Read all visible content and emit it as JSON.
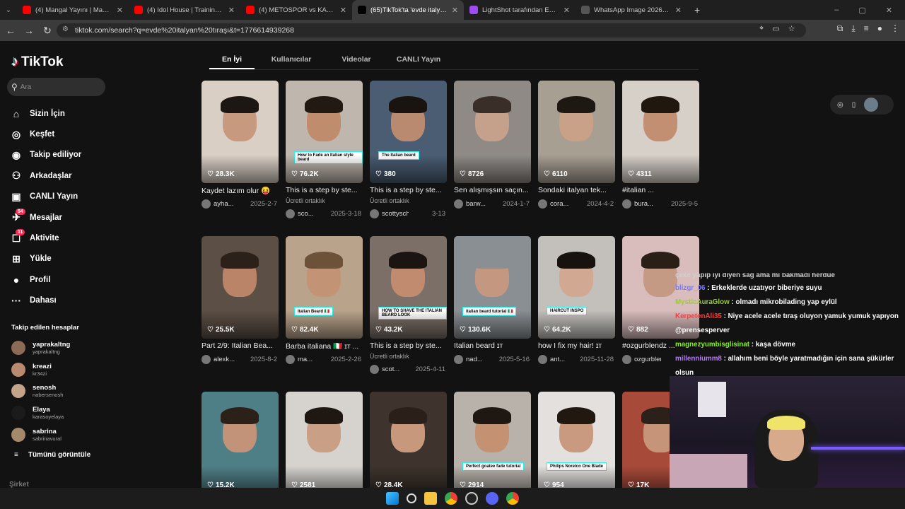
{
  "browser": {
    "tabs": [
      {
        "title": "(4) Mangal Yayını | Mangal ve S",
        "color": "#ff0000",
        "active": false
      },
      {
        "title": "(4) Idol House | Training EP 11 |",
        "color": "#ff0000",
        "active": false
      },
      {
        "title": "(4) METOSPOR vs KADİM FUTBO",
        "color": "#ff0000",
        "active": false
      },
      {
        "title": "(65)TikTok'ta 'evde italyan tıraşı'",
        "color": "#000000",
        "active": true
      },
      {
        "title": "LightShot tarafından Ekran Gör",
        "color": "#9c4cf0",
        "active": false
      },
      {
        "title": "WhatsApp Image 2026-04-15 a",
        "color": "#555555",
        "active": false
      }
    ],
    "new_tab": "+",
    "url": "tiktok.com/search?q=evde%20italyan%20tıraşı&t=1776614939268"
  },
  "tiktok": {
    "brand": "TikTok",
    "search_placeholder": "Ara",
    "nav": [
      {
        "label": "Sizin İçin",
        "icon": "home-icon",
        "glyph": "⌂"
      },
      {
        "label": "Keşfet",
        "icon": "compass-icon",
        "glyph": "◎"
      },
      {
        "label": "Takip ediliyor",
        "icon": "following-icon",
        "glyph": "◉"
      },
      {
        "label": "Arkadaşlar",
        "icon": "friends-icon",
        "glyph": "⚇"
      },
      {
        "label": "CANLI Yayın",
        "icon": "live-icon",
        "glyph": "▣"
      },
      {
        "label": "Mesajlar",
        "icon": "messages-icon",
        "glyph": "✈",
        "badge": "54"
      },
      {
        "label": "Aktivite",
        "icon": "activity-icon",
        "glyph": "☐",
        "badge": "11"
      },
      {
        "label": "Yükle",
        "icon": "upload-icon",
        "glyph": "⊞"
      },
      {
        "label": "Profil",
        "icon": "profile-icon",
        "glyph": "●"
      },
      {
        "label": "Dahası",
        "icon": "more-icon",
        "glyph": "···"
      }
    ],
    "following_title": "Takip edilen hesaplar",
    "following": [
      {
        "name": "yaprakaltng",
        "user": "yaprakaltng"
      },
      {
        "name": "kreazi",
        "user": "kr34zi"
      },
      {
        "name": "senosh",
        "user": "nabersenosh"
      },
      {
        "name": "Elaya",
        "user": "karasoyelaya"
      },
      {
        "name": "sabrina",
        "user": "sabrinavural"
      }
    ],
    "see_all": "Tümünü görüntüle",
    "company": "Şirket",
    "search_tabs": [
      "En İyi",
      "Kullanıcılar",
      "Videolar",
      "CANLI Yayın"
    ],
    "paid_label": "Ücretli ortaklık",
    "videos": [
      {
        "likes": "28.3K",
        "caption": "Kaydet lazım olur 😝",
        "author": "ayha...",
        "date": "2025-2-7",
        "paid": false,
        "bg": "#d9cfc5",
        "skin": "#c79a80",
        "hair": "#1d1713"
      },
      {
        "likes": "76.2K",
        "caption": "This is a step by ste...",
        "author": "sco...",
        "date": "2025-3-18",
        "paid": true,
        "bg": "#bfb6ad",
        "skin": "#c08c6e",
        "hair": "#231913",
        "label": "How to Fade an Italian style beard"
      },
      {
        "likes": "380",
        "caption": "This is a step by ste...",
        "author": "scottysch...",
        "date": "3-13",
        "paid": true,
        "bg": "#4a5d73",
        "skin": "#b98a70",
        "hair": "#1a1411",
        "label": "The Italian beard"
      },
      {
        "likes": "8726",
        "caption": "Sen alışmışsın saçın...",
        "author": "barw...",
        "date": "2024-1-7",
        "paid": false,
        "bg": "#8f8a86",
        "skin": "#c5a08a",
        "hair": "#3a2f28"
      },
      {
        "likes": "6110",
        "caption": "Sondaki italyan tek...",
        "author": "cora...",
        "date": "2024-4-2",
        "paid": false,
        "bg": "#a89f93",
        "skin": "#c9a088",
        "hair": "#1e1813"
      },
      {
        "likes": "4311",
        "caption": "#italian ...",
        "author": "bura...",
        "date": "2025-9-5",
        "paid": false,
        "bg": "#d7d0c9",
        "skin": "#c28f72",
        "hair": "#20180f"
      },
      {
        "likes": "25.5K",
        "caption": "Part 2/9: Italian Bea...",
        "author": "alexk...",
        "date": "2025-8-2",
        "paid": false,
        "bg": "#5c4f45",
        "skin": "#b98468",
        "hair": "#2c2119"
      },
      {
        "likes": "82.4K",
        "caption": "Barba italiana 🇮🇹 ɪᴛ ...",
        "author": "ma...",
        "date": "2025-2-26",
        "paid": false,
        "bg": "#b9a38b",
        "skin": "#c39376",
        "hair": "#6b5238",
        "label": "Italian Beard 🇮🇹"
      },
      {
        "likes": "43.2K",
        "caption": "This is a step by ste...",
        "author": "scot...",
        "date": "2025-4-11",
        "paid": true,
        "bg": "#7b6f67",
        "skin": "#c08b6e",
        "hair": "#1b1410",
        "label": "HOW TO SHAVE THE ITALIAN BEARD LOOK"
      },
      {
        "likes": "130.6K",
        "caption": "Italian beard ɪᴛ",
        "author": "nad...",
        "date": "2025-5-16",
        "paid": false,
        "bg": "#8a8f94",
        "skin": "#c49880",
        "hair": "#8a8f94",
        "label": "italian beard tutorial 🇮🇹"
      },
      {
        "likes": "64.2K",
        "caption": "how I fix my hair! ɪᴛ",
        "author": "ant...",
        "date": "2025-11-28",
        "paid": false,
        "bg": "#c3c0bc",
        "skin": "#d1a891",
        "hair": "#17120e",
        "label": "HAIRCUT INSPO"
      },
      {
        "likes": "882",
        "caption": "#ozgurblendz ...",
        "author": "ozgurblen...",
        "date": "",
        "paid": false,
        "bg": "#d9bcbc",
        "skin": "#c59a85",
        "hair": "#2a1f17"
      },
      {
        "likes": "15.2K",
        "caption": "",
        "author": "",
        "date": "",
        "paid": false,
        "bg": "#4f7f86",
        "skin": "#c29378",
        "hair": "#2b2119"
      },
      {
        "likes": "2581",
        "caption": "",
        "author": "",
        "date": "",
        "paid": false,
        "bg": "#d6d3cf",
        "skin": "#c99f86",
        "hair": "#1f1812"
      },
      {
        "likes": "28.4K",
        "caption": "",
        "author": "",
        "date": "",
        "paid": false,
        "bg": "#3e342d",
        "skin": "#c7987c",
        "hair": "#2a2019"
      },
      {
        "likes": "2914",
        "caption": "",
        "author": "",
        "date": "",
        "paid": false,
        "bg": "#b8b2ab",
        "skin": "#c49173",
        "hair": "#1e1712",
        "label": "Perfect goatee fade tutorial"
      },
      {
        "likes": "954",
        "caption": "",
        "author": "",
        "date": "",
        "paid": false,
        "bg": "#e3e0dd",
        "skin": "#c99a7f",
        "hair": "#21180f",
        "label": "Philips Norelco One Blade"
      },
      {
        "likes": "17K",
        "caption": "",
        "author": "",
        "date": "",
        "paid": false,
        "bg": "#a84a3a",
        "skin": "#c69478",
        "hair": "#2c211a"
      }
    ]
  },
  "chat": [
    {
      "user": "",
      "msg": "çeke yapıp iyi diyen sağ ama mı bakmadı herdue",
      "color": "#cfcfcf"
    },
    {
      "user": "blizgr_06",
      "msg": "Erkeklerde uzatıyor biberiye suyu",
      "color": "#7a7aff"
    },
    {
      "user": "MysticAuraGlow",
      "msg": "olmadı mikrobilading yap eylül",
      "color": "#9acd32"
    },
    {
      "user": "KerpetenAli35",
      "msg": "Niye acele acele tıraş oluyon yamuk yumuk yapıyon @prensesperver",
      "color": "#ff3b3b"
    },
    {
      "user": "magnezyumbisglisinat",
      "msg": "kaşa dövme",
      "color": "#7cfc00"
    },
    {
      "user": "millenniumm8",
      "msg": "allahım beni böyle yaratmadığın için sana şükürler olsun",
      "color": "#b57bff"
    }
  ]
}
